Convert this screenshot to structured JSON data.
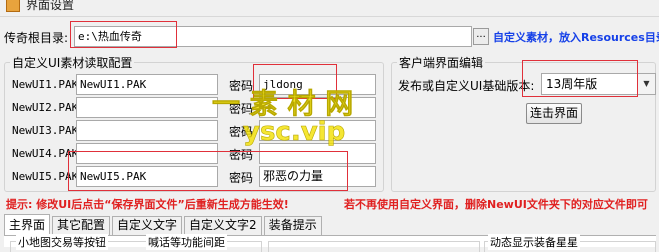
{
  "window": {
    "title": "界面设置"
  },
  "root_dir": {
    "label": "传奇根目录:",
    "value": "e:\\热血传奇",
    "browse_label": "...",
    "note": "自定义素材，放入Resources目录"
  },
  "pak_group": {
    "title": "自定义UI素材读取配置",
    "password_label": "密码",
    "rows": [
      {
        "name": "NewUI1.PAK",
        "file": "NewUI1.PAK",
        "password": "jldong"
      },
      {
        "name": "NewUI2.PAK",
        "file": "",
        "password": ""
      },
      {
        "name": "NewUI3.PAK",
        "file": "",
        "password": ""
      },
      {
        "name": "NewUI4.PAK",
        "file": "",
        "password": ""
      },
      {
        "name": "NewUI5.PAK",
        "file": "NewUI5.PAK",
        "password": "邪恶の力量"
      }
    ]
  },
  "client_group": {
    "title": "客户端界面编辑",
    "version_label": "发布或自定义UI基础版本:",
    "version_value": "13周年版",
    "connect_button": "连击界面"
  },
  "hint": {
    "left": "提示: 修改UI后点击“保存界面文件”后重新生成方能生效!",
    "right": "若不再使用自定义界面，删除NewUI文件夹下的对应文件即可"
  },
  "tabs": [
    "主界面",
    "其它配置",
    "自定义文字",
    "自定义文字2",
    "装备提示"
  ],
  "tab_body": {
    "group1": "小地图交易等按钮",
    "group2": "喊话等功能间距",
    "group3": "动态显示装备星星"
  },
  "watermark": {
    "line1": "一 素 材 网",
    "line2": "ysc.vip"
  }
}
